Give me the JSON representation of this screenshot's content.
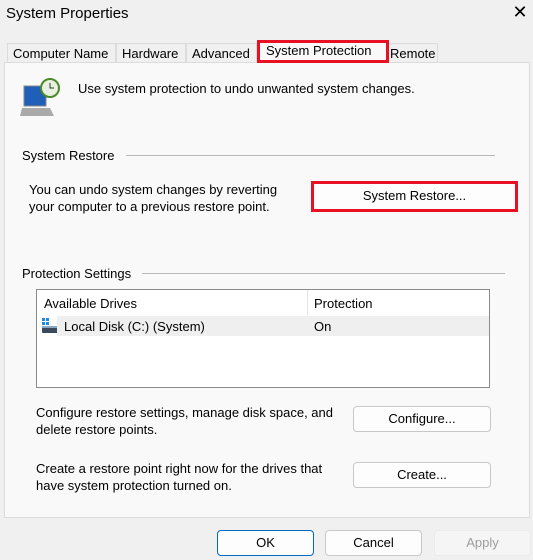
{
  "window": {
    "title": "System Properties",
    "close_label": "✕"
  },
  "tabs": [
    {
      "label": "Computer Name"
    },
    {
      "label": "Hardware"
    },
    {
      "label": "Advanced"
    },
    {
      "label": "System Protection",
      "active": true
    },
    {
      "label": "Remote"
    }
  ],
  "intro": "Use system protection to undo unwanted system changes.",
  "restore": {
    "heading": "System Restore",
    "text_line1": "You can undo system changes by reverting",
    "text_line2": "your computer to a previous restore point.",
    "button": "System Restore..."
  },
  "protection": {
    "heading": "Protection Settings",
    "columns": [
      "Available Drives",
      "Protection"
    ],
    "rows": [
      {
        "drive": "Local Disk (C:) (System)",
        "status": "On",
        "icon": "drive-icon"
      }
    ],
    "configure_text1": "Configure restore settings, manage disk space, and",
    "configure_text2": "delete restore points.",
    "configure_button": "Configure...",
    "create_text1": "Create a restore point right now for the drives that",
    "create_text2": "have system protection turned on.",
    "create_button": "Create..."
  },
  "footer": {
    "ok": "OK",
    "cancel": "Cancel",
    "apply": "Apply"
  },
  "colors": {
    "highlight": "#e81123",
    "accent": "#0067c0"
  }
}
